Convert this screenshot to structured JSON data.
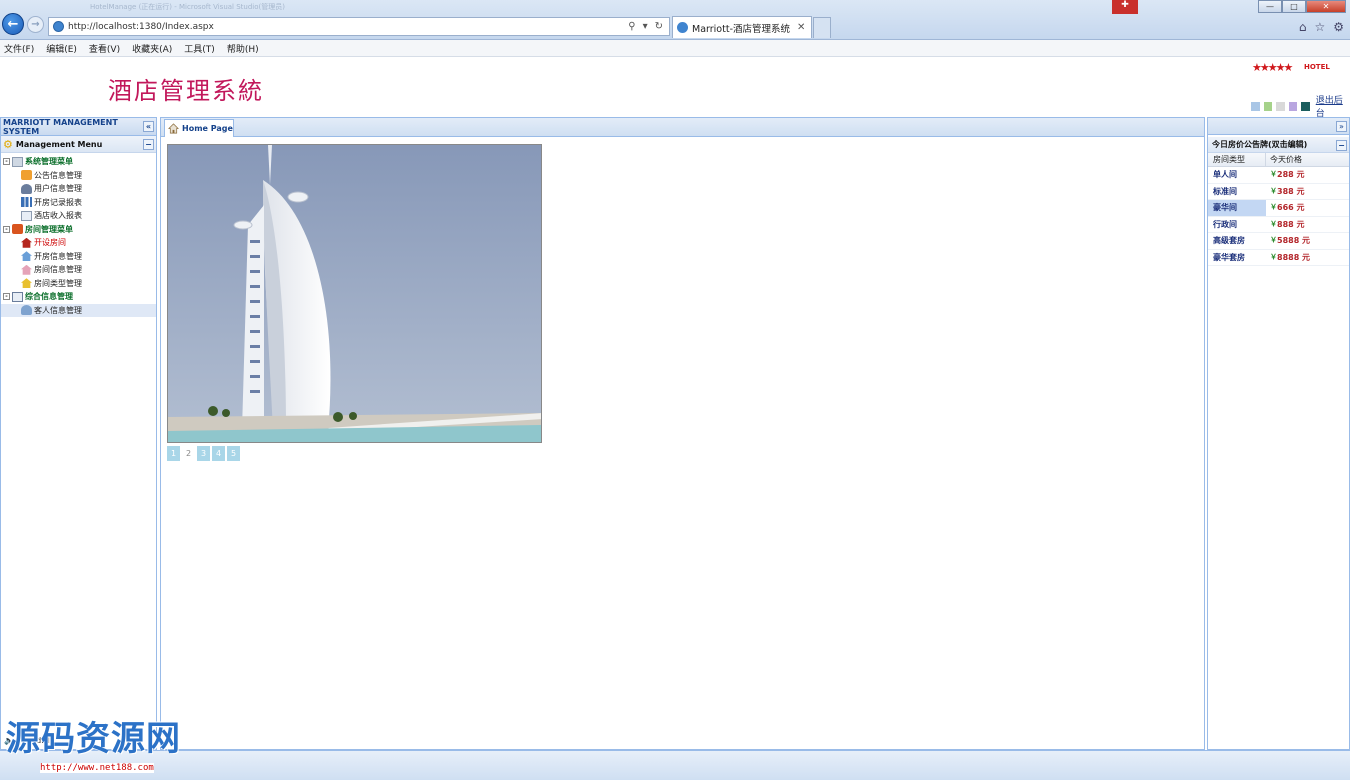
{
  "browser": {
    "url": "http://localhost:1380/Index.aspx",
    "tab_title": "Marriott-酒店管理系统",
    "faded_titles": "HotelManage (正在运行) - Microsoft Visual Studio(管理员)"
  },
  "menubar": [
    "文件(F)",
    "编辑(E)",
    "查看(V)",
    "收藏夹(A)",
    "工具(T)",
    "帮助(H)"
  ],
  "header": {
    "title": "酒店管理系統",
    "stars": "★★★★★",
    "hotel_word": "HOTEL",
    "logout": "退出后台",
    "theme_colors": [
      "#a9c6e6",
      "#a6d28a",
      "#d9d9d9",
      "#b9a6e0",
      "#1b5e5e"
    ]
  },
  "left_panel": {
    "title": "MARRIOTT MANAGEMENT SYSTEM",
    "menu_title": "Management Menu",
    "groups": [
      {
        "label": "系统管理菜单",
        "items": [
          "公告信息管理",
          "用户信息管理",
          "开房记录报表",
          "酒店收入报表"
        ]
      },
      {
        "label": "房间管理菜单",
        "items": [
          "开设房间",
          "开房信息管理",
          "房间信息管理",
          "房间类型管理"
        ]
      },
      {
        "label": "综合信息管理",
        "items": [
          "客人信息管理"
        ]
      }
    ],
    "sound_label": "Sound:No"
  },
  "center": {
    "tab_label": "Home Page",
    "pages": [
      "1",
      "2",
      "3",
      "4",
      "5"
    ],
    "current_page": "2"
  },
  "right_panel": {
    "title": "今日房价公告牌(双击编辑)",
    "col_type": "房间类型",
    "col_price": "今天价格",
    "currency": "￥",
    "rows": [
      {
        "type": "单人间",
        "price": "288 元"
      },
      {
        "type": "标准间",
        "price": "388 元"
      },
      {
        "type": "豪华间",
        "price": "666 元"
      },
      {
        "type": "行政间",
        "price": "888 元"
      },
      {
        "type": "高级套房",
        "price": "5888 元"
      },
      {
        "type": "豪华套房",
        "price": "8888 元"
      }
    ],
    "selected_row": "豪华间"
  },
  "watermark": {
    "text": "源码资源网",
    "url": "http://www.net188.com"
  }
}
